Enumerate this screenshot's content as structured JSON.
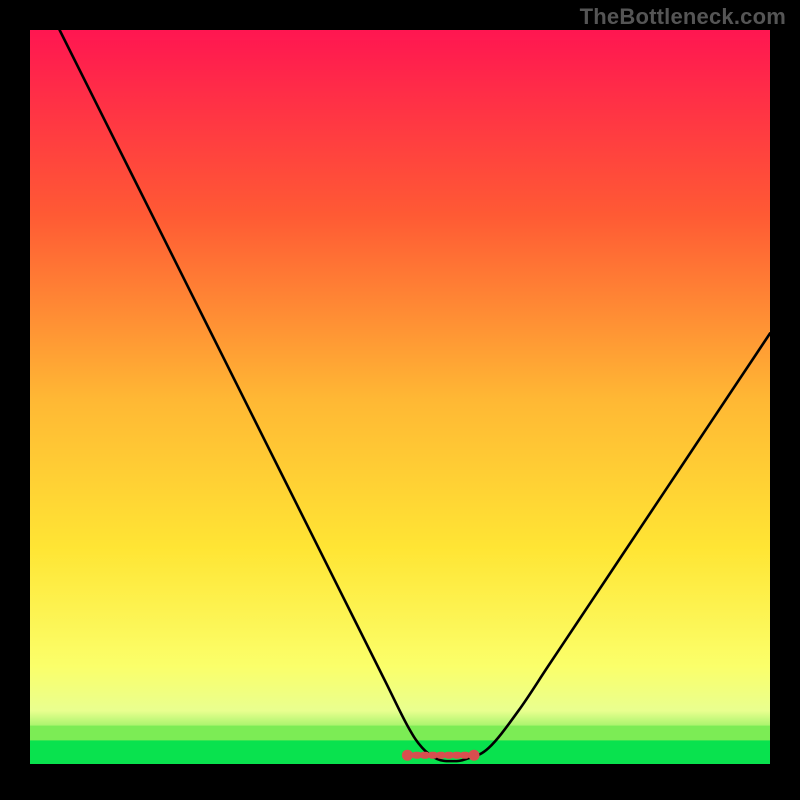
{
  "watermark": "TheBottleneck.com",
  "colors": {
    "background": "#000000",
    "curve": "#000000",
    "bottom_band_outer": "#09e24e",
    "bottom_band_inner": "#7cec55",
    "marker": "#d84f4f",
    "gradient_stops": [
      {
        "offset": 0.0,
        "color": "#ff1651"
      },
      {
        "offset": 0.25,
        "color": "#ff5a34"
      },
      {
        "offset": 0.5,
        "color": "#ffb834"
      },
      {
        "offset": 0.7,
        "color": "#ffe534"
      },
      {
        "offset": 0.86,
        "color": "#fbff6a"
      },
      {
        "offset": 0.92,
        "color": "#e9ff8f"
      },
      {
        "offset": 0.955,
        "color": "#7cec55"
      },
      {
        "offset": 0.975,
        "color": "#09e24e"
      },
      {
        "offset": 1.0,
        "color": "#000000"
      }
    ]
  },
  "chart_data": {
    "type": "line",
    "title": "",
    "xlabel": "",
    "ylabel": "",
    "xlim": [
      0,
      100
    ],
    "ylim": [
      0,
      100
    ],
    "x": [
      4,
      8,
      12,
      16,
      20,
      24,
      28,
      32,
      36,
      40,
      44,
      48,
      51,
      53,
      55,
      57,
      59,
      62,
      66,
      70,
      74,
      78,
      82,
      86,
      90,
      94,
      98,
      100
    ],
    "values": [
      100,
      92,
      84,
      76,
      68,
      60,
      52,
      44,
      36,
      28,
      20,
      12,
      6,
      3,
      1.5,
      1.2,
      1.5,
      3,
      8,
      14,
      20,
      26,
      32,
      38,
      44,
      50,
      56,
      59
    ],
    "floor_marker": {
      "x_start": 51,
      "x_end": 60,
      "y": 0,
      "label": ""
    }
  }
}
